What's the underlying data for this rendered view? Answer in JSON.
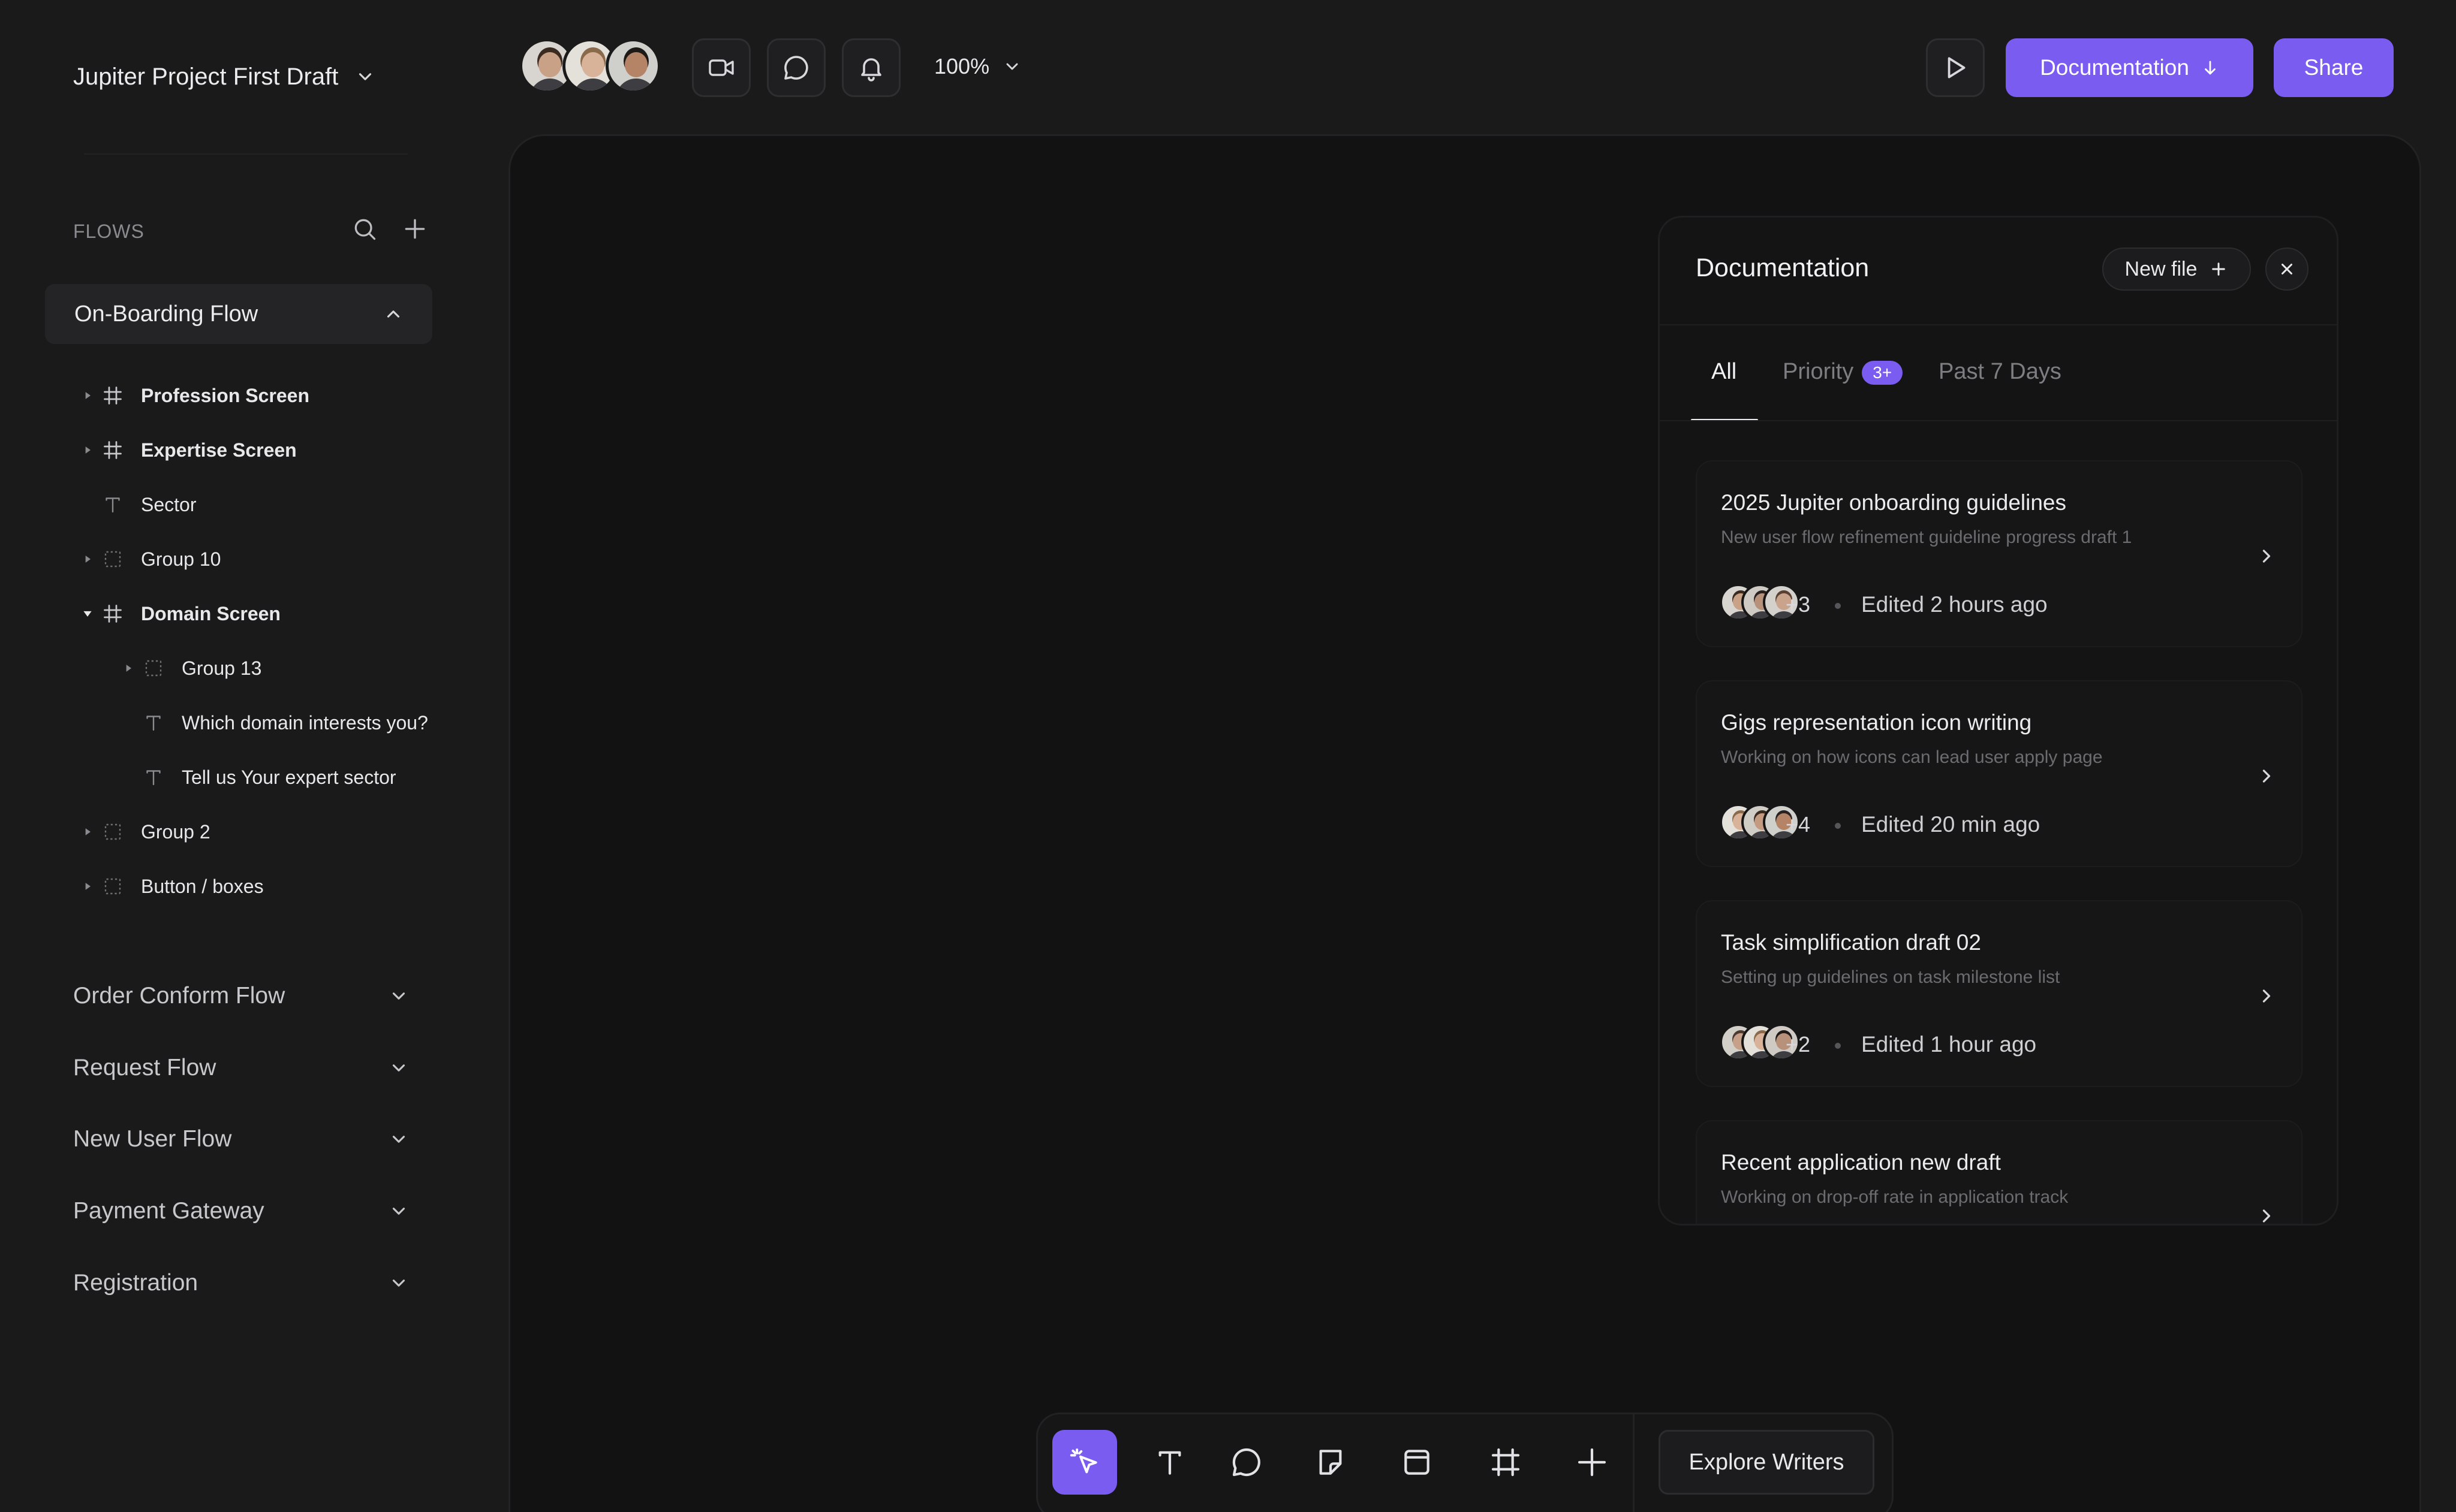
{
  "project": {
    "title": "Jupiter Project First Draft"
  },
  "toolbar": {
    "collaborators": [
      {
        "name": "collaborator-1",
        "skin": "#c9a186",
        "hair": "#3a2a20",
        "bg": "#d8d4cf"
      },
      {
        "name": "collaborator-2",
        "skin": "#d8b39a",
        "hair": "#8a6a4a",
        "bg": "#e4e0da"
      },
      {
        "name": "collaborator-3",
        "skin": "#b58466",
        "hair": "#1e1a18",
        "bg": "#cfd0cc"
      }
    ],
    "icons": [
      "video-icon",
      "comment-icon",
      "bell-icon"
    ],
    "zoom": "100%",
    "documentation_label": "Documentation",
    "share_label": "Share"
  },
  "sidebar": {
    "flows_heading": "FLOWS",
    "active_flow": "On-Boarding Flow",
    "tree": [
      {
        "label": "Profession Screen",
        "icon": "frame",
        "level": 0,
        "caret": "right",
        "bold": true
      },
      {
        "label": "Expertise Screen",
        "icon": "frame",
        "level": 0,
        "caret": "right",
        "bold": true
      },
      {
        "label": "Sector",
        "icon": "text",
        "level": 0,
        "caret": "none",
        "bold": false
      },
      {
        "label": "Group 10",
        "icon": "group",
        "level": 0,
        "caret": "right",
        "bold": false
      },
      {
        "label": "Domain Screen",
        "icon": "frame",
        "level": 0,
        "caret": "down",
        "bold": true
      },
      {
        "label": "Group 13",
        "icon": "group",
        "level": 1,
        "caret": "right",
        "bold": false
      },
      {
        "label": "Which domain interests you?",
        "icon": "text",
        "level": 1,
        "caret": "none",
        "bold": false
      },
      {
        "label": "Tell us Your expert sector",
        "icon": "text",
        "level": 1,
        "caret": "none",
        "bold": false
      },
      {
        "label": "Group 2",
        "icon": "group",
        "level": 0,
        "caret": "right",
        "bold": false
      },
      {
        "label": "Button / boxes",
        "icon": "group",
        "level": 0,
        "caret": "right",
        "bold": false
      }
    ],
    "flows": [
      "Order Conform Flow",
      "Request Flow",
      "New User Flow",
      "Payment Gateway",
      "Registration"
    ]
  },
  "panel": {
    "title": "Documentation",
    "new_file_label": "New file",
    "tabs": {
      "all": "All",
      "priority": "Priority",
      "priority_badge": "3+",
      "past": "Past 7 Days"
    },
    "docs": [
      {
        "title": "2025 Jupiter onboarding guidelines",
        "subtitle": "New user flow refinement guideline progress draft 1",
        "count": "+3",
        "edited": "Edited 2 hours ago"
      },
      {
        "title": "Gigs representation icon writing",
        "subtitle": "Working on how icons can lead user apply page",
        "count": "+4",
        "edited": "Edited 20 min ago"
      },
      {
        "title": "Task simplification draft 02",
        "subtitle": "Setting up guidelines on task milestone list",
        "count": "+2",
        "edited": "Edited 1 hour ago"
      },
      {
        "title": "Recent application new draft",
        "subtitle": "Working on  drop-off rate in application track",
        "count": "",
        "edited": ""
      }
    ]
  },
  "bottom_toolbar": {
    "tools": [
      "select-tool-icon",
      "text-tool-icon",
      "comment-tool-icon",
      "sticky-note-tool-icon",
      "section-tool-icon",
      "frame-tool-icon",
      "add-tool-icon"
    ],
    "explore_label": "Explore Writers"
  },
  "colors": {
    "accent": "#7a5cf0",
    "background": "#1a1a1b",
    "canvas": "#121213"
  }
}
